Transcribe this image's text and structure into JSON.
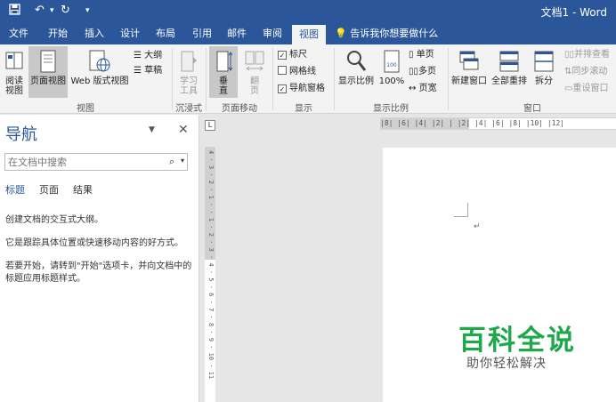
{
  "app": {
    "title": "文档1  -  Word",
    "brand_color": "#2b579a"
  },
  "quick_access": {
    "save_icon": "save-icon",
    "undo_icon": "undo-icon",
    "redo_icon": "redo-icon",
    "customize_icon": "customize-icon"
  },
  "tabs": [
    {
      "label": "文件"
    },
    {
      "label": "开始"
    },
    {
      "label": "插入"
    },
    {
      "label": "设计"
    },
    {
      "label": "布局"
    },
    {
      "label": "引用"
    },
    {
      "label": "邮件"
    },
    {
      "label": "审阅"
    },
    {
      "label": "视图"
    }
  ],
  "tell_me": "告诉我你想要做什么",
  "ribbon": {
    "view_group": {
      "label": "视图",
      "read_mode": "阅读\n视图",
      "print_layout": "页面视图",
      "web_layout": "Web 版式视图",
      "outline": "大纲",
      "draft": "草稿"
    },
    "immersive_group": {
      "label": "沉浸式",
      "learning_tools": "学习\n工具"
    },
    "page_movement_group": {
      "label": "页面移动",
      "vertical": "垂\n直",
      "side_to_side": "翻\n页"
    },
    "show_group": {
      "label": "显示",
      "ruler": "标尺",
      "ruler_checked": true,
      "gridlines": "网格线",
      "gridlines_checked": false,
      "nav_pane": "导航窗格",
      "nav_pane_checked": true
    },
    "zoom_group": {
      "label": "显示比例",
      "zoom": "显示比例",
      "percent": "100%",
      "one_page": "单页",
      "multiple_pages": "多页",
      "page_width": "页宽"
    },
    "window_group": {
      "label": "窗口",
      "new_window": "新建窗口",
      "arrange_all": "全部重排",
      "split": "拆分",
      "side_by_side": "并排查看",
      "sync_scroll": "同步滚动",
      "reset_position": "重设窗口"
    }
  },
  "nav_pane": {
    "title": "导航",
    "search_placeholder": "在文档中搜索",
    "tabs": [
      "标题",
      "页面",
      "结果"
    ],
    "text1": "创建文档的交互式大纲。",
    "text2": "它是跟踪具体位置或快速移动内容的好方式。",
    "text3": "若要开始，请转到\"开始\"选项卡，并向文档中的标题应用标题样式。"
  },
  "ruler": {
    "tab_selector": "L",
    "h_ticks": "|8|  |6|  |4|  |2|  |  |2|  |4|  |6|  |8|  |10|  |12|",
    "v_ticks": "4 · 3 · 2 · 1 · · 1 · 2 · 3 · 4 · 5 · 6 · 7 · 8 · 9 · 10 · 11"
  },
  "document": {
    "paragraph_mark": "↵"
  },
  "watermark": {
    "main": "百科全说",
    "sub": "助你轻松解决"
  }
}
